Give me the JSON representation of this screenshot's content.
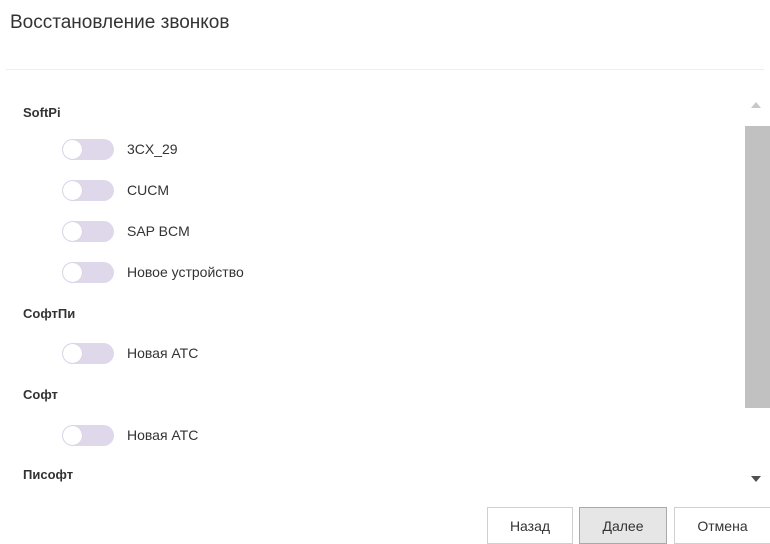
{
  "dialog": {
    "title": "Восстановление звонков"
  },
  "groups": [
    {
      "label": "SoftPi",
      "items": [
        {
          "label": "3CX_29",
          "enabled": false
        },
        {
          "label": "CUCM",
          "enabled": false
        },
        {
          "label": "SAP BCM",
          "enabled": false
        },
        {
          "label": "Новое устройство",
          "enabled": false
        }
      ]
    },
    {
      "label": "СофтПи",
      "items": [
        {
          "label": "Новая АТС",
          "enabled": false
        }
      ]
    },
    {
      "label": "Софт",
      "items": [
        {
          "label": "Новая АТС",
          "enabled": false
        }
      ]
    },
    {
      "label": "Писофт",
      "items": []
    }
  ],
  "footer": {
    "back_label": "Назад",
    "next_label": "Далее",
    "cancel_label": "Отмена"
  },
  "colors": {
    "toggle_off": "#ded8ea",
    "scroll_thumb": "#c1c1c1"
  }
}
